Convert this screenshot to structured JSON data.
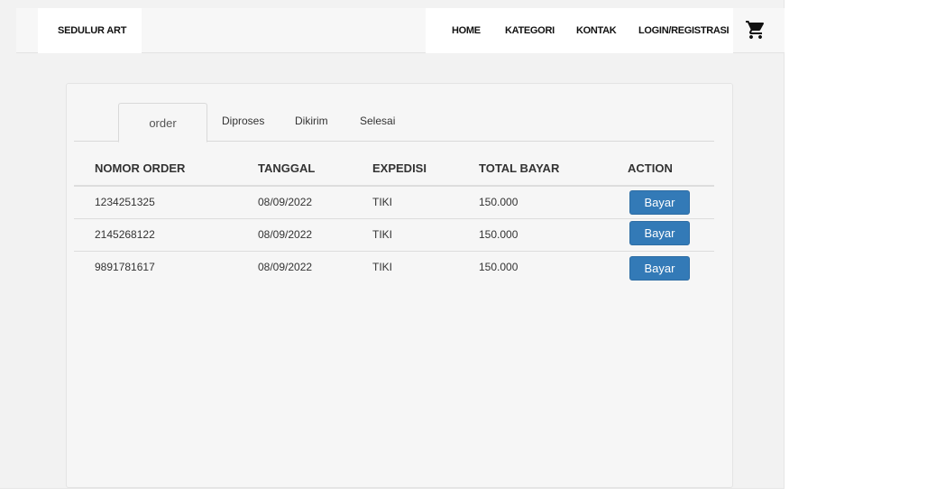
{
  "brand": "SEDULUR ART",
  "nav": {
    "home": "HOME",
    "kategori": "KATEGORI",
    "kontak": "KONTAK",
    "login": "LOGIN/REGISTRASI",
    "cart_icon": "shopping-cart-icon"
  },
  "tabs": [
    {
      "label": "order",
      "active": true
    },
    {
      "label": "Diproses",
      "active": false
    },
    {
      "label": "Dikirim",
      "active": false
    },
    {
      "label": "Selesai",
      "active": false
    }
  ],
  "table": {
    "headers": [
      "NOMOR ORDER",
      "TANGGAL",
      "EXPEDISI",
      "TOTAL BAYAR",
      "ACTION"
    ],
    "rows": [
      {
        "nomor": "1234251325",
        "tanggal": "08/09/2022",
        "expedisi": "TIKI",
        "total": "150.000",
        "action": "Bayar"
      },
      {
        "nomor": "2145268122",
        "tanggal": "08/09/2022",
        "expedisi": "TIKI",
        "total": "150.000",
        "action": "Bayar"
      },
      {
        "nomor": "9891781617",
        "tanggal": "08/09/2022",
        "expedisi": "TIKI",
        "total": "150.000",
        "action": "Bayar"
      }
    ]
  },
  "colors": {
    "primary_button": "#337ab7",
    "background": "#f2f2f2"
  }
}
